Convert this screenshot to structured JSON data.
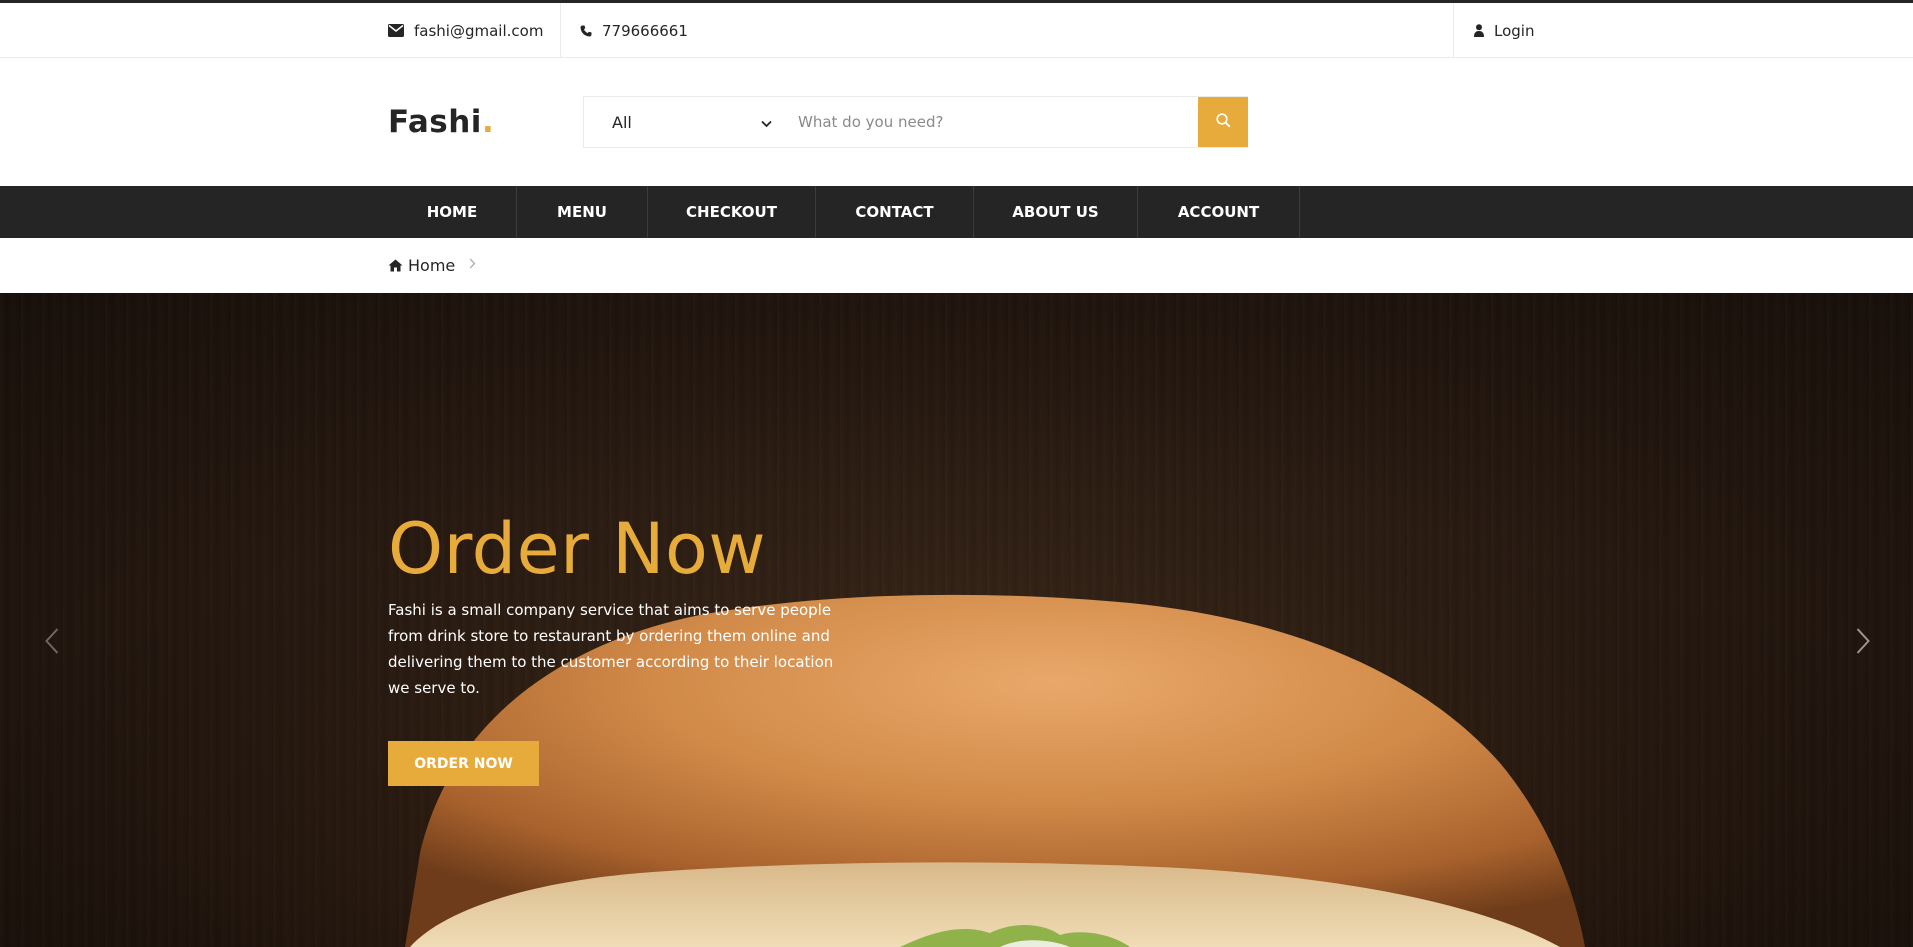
{
  "topbar": {
    "email": "fashi@gmail.com",
    "phone": "779666661",
    "login_label": "Login",
    "email_icon": "envelope-icon",
    "phone_icon": "phone-icon",
    "login_icon": "user-icon"
  },
  "header": {
    "logo_text": "Fashi",
    "logo_dot": ".",
    "search": {
      "category_value": "All",
      "placeholder": "What do you need?",
      "button_icon": "search-icon"
    }
  },
  "nav": {
    "items": [
      {
        "label": "HOME"
      },
      {
        "label": "MENU"
      },
      {
        "label": "CHECKOUT"
      },
      {
        "label": "CONTACT"
      },
      {
        "label": "ABOUT US"
      },
      {
        "label": "ACCOUNT"
      }
    ]
  },
  "breadcrumb": {
    "home_label": "Home",
    "home_icon": "home-icon",
    "separator_icon": "chevron-right-icon"
  },
  "hero": {
    "title": "Order Now",
    "description": "Fashi is a small company service that aims to serve people from drink store to restaurant by ordering them online and delivering them to the customer according to their location we serve to.",
    "button_label": "ORDER NOW",
    "prev_icon": "chevron-left-icon",
    "next_icon": "chevron-right-icon"
  },
  "colors": {
    "accent": "#e7ab3c",
    "dark": "#252525",
    "border": "#ebebeb"
  }
}
